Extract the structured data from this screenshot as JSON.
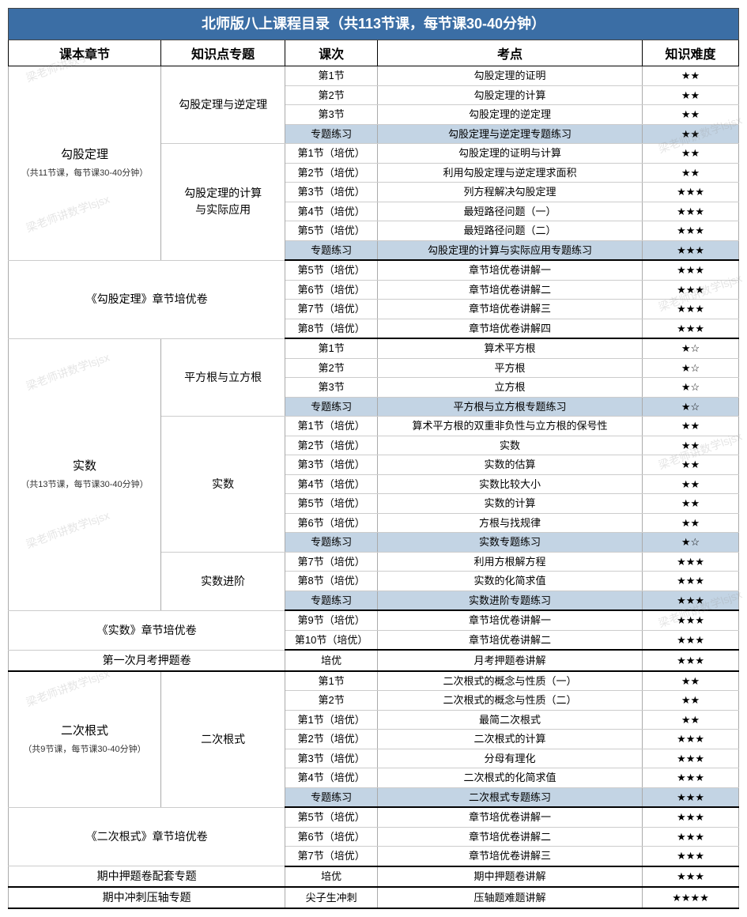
{
  "title": "北师版八上课程目录（共113节课，每节课30-40分钟）",
  "headers": [
    "课本章节",
    "知识点专题",
    "课次",
    "考点",
    "知识难度"
  ],
  "watermark": "梁老师讲数学lsjsx",
  "chapters": {
    "gougu": {
      "name": "勾股定理",
      "sub": "（共11节课，每节课30-40分钟）"
    },
    "gougu_topic1": "勾股定理与逆定理",
    "gougu_topic2_l1": "勾股定理的计算",
    "gougu_topic2_l2": "与实际应用",
    "gougu_exam": "《勾股定理》章节培优卷",
    "shishu": {
      "name": "实数",
      "sub": "（共13节课，每节课30-40分钟）"
    },
    "shishu_topic1": "平方根与立方根",
    "shishu_topic2": "实数",
    "shishu_topic3": "实数进阶",
    "shishu_exam": "《实数》章节培优卷",
    "monthly1": "第一次月考押题卷",
    "erci": {
      "name": "二次根式",
      "sub": "（共9节课，每节课30-40分钟）"
    },
    "erci_topic1": "二次根式",
    "erci_exam": "《二次根式》章节培优卷",
    "midterm1": "期中押题卷配套专题",
    "midterm2": "期中冲刺压轴专题"
  },
  "rows": [
    {
      "lesson": "第1节",
      "point": "勾股定理的证明",
      "diff": "★★"
    },
    {
      "lesson": "第2节",
      "point": "勾股定理的计算",
      "diff": "★★"
    },
    {
      "lesson": "第3节",
      "point": "勾股定理的逆定理",
      "diff": "★★"
    },
    {
      "lesson": "专题练习",
      "point": "勾股定理与逆定理专题练习",
      "diff": "★★",
      "hl": true
    },
    {
      "lesson": "第1节（培优）",
      "point": "勾股定理的证明与计算",
      "diff": "★★"
    },
    {
      "lesson": "第2节（培优）",
      "point": "利用勾股定理与逆定理求面积",
      "diff": "★★"
    },
    {
      "lesson": "第3节（培优）",
      "point": "列方程解决勾股定理",
      "diff": "★★★"
    },
    {
      "lesson": "第4节（培优）",
      "point": "最短路径问题（一）",
      "diff": "★★★"
    },
    {
      "lesson": "第5节（培优）",
      "point": "最短路径问题（二）",
      "diff": "★★★"
    },
    {
      "lesson": "专题练习",
      "point": "勾股定理的计算与实际应用专题练习",
      "diff": "★★★",
      "hl": true
    },
    {
      "lesson": "第5节（培优）",
      "point": "章节培优卷讲解一",
      "diff": "★★★"
    },
    {
      "lesson": "第6节（培优）",
      "point": "章节培优卷讲解二",
      "diff": "★★★"
    },
    {
      "lesson": "第7节（培优）",
      "point": "章节培优卷讲解三",
      "diff": "★★★"
    },
    {
      "lesson": "第8节（培优）",
      "point": "章节培优卷讲解四",
      "diff": "★★★"
    },
    {
      "lesson": "第1节",
      "point": "算术平方根",
      "diff": "★☆"
    },
    {
      "lesson": "第2节",
      "point": "平方根",
      "diff": "★☆"
    },
    {
      "lesson": "第3节",
      "point": "立方根",
      "diff": "★☆"
    },
    {
      "lesson": "专题练习",
      "point": "平方根与立方根专题练习",
      "diff": "★☆",
      "hl": true
    },
    {
      "lesson": "第1节（培优）",
      "point": "算术平方根的双重非负性与立方根的保号性",
      "diff": "★★"
    },
    {
      "lesson": "第2节（培优）",
      "point": "实数",
      "diff": "★★"
    },
    {
      "lesson": "第3节（培优）",
      "point": "实数的估算",
      "diff": "★★"
    },
    {
      "lesson": "第4节（培优）",
      "point": "实数比较大小",
      "diff": "★★"
    },
    {
      "lesson": "第5节（培优）",
      "point": "实数的计算",
      "diff": "★★"
    },
    {
      "lesson": "第6节（培优）",
      "point": "方根与找规律",
      "diff": "★★"
    },
    {
      "lesson": "专题练习",
      "point": "实数专题练习",
      "diff": "★☆",
      "hl": true
    },
    {
      "lesson": "第7节（培优）",
      "point": "利用方根解方程",
      "diff": "★★★"
    },
    {
      "lesson": "第8节（培优）",
      "point": "实数的化简求值",
      "diff": "★★★"
    },
    {
      "lesson": "专题练习",
      "point": "实数进阶专题练习",
      "diff": "★★★",
      "hl": true
    },
    {
      "lesson": "第9节（培优）",
      "point": "章节培优卷讲解一",
      "diff": "★★★"
    },
    {
      "lesson": "第10节（培优）",
      "point": "章节培优卷讲解二",
      "diff": "★★★"
    },
    {
      "lesson": "培优",
      "point": "月考押题卷讲解",
      "diff": "★★★"
    },
    {
      "lesson": "第1节",
      "point": "二次根式的概念与性质（一）",
      "diff": "★★"
    },
    {
      "lesson": "第2节",
      "point": "二次根式的概念与性质（二）",
      "diff": "★★"
    },
    {
      "lesson": "第1节（培优）",
      "point": "最简二次根式",
      "diff": "★★"
    },
    {
      "lesson": "第2节（培优）",
      "point": "二次根式的计算",
      "diff": "★★★"
    },
    {
      "lesson": "第3节（培优）",
      "point": "分母有理化",
      "diff": "★★★"
    },
    {
      "lesson": "第4节（培优）",
      "point": "二次根式的化简求值",
      "diff": "★★★"
    },
    {
      "lesson": "专题练习",
      "point": "二次根式专题练习",
      "diff": "★★★",
      "hl": true
    },
    {
      "lesson": "第5节（培优）",
      "point": "章节培优卷讲解一",
      "diff": "★★★"
    },
    {
      "lesson": "第6节（培优）",
      "point": "章节培优卷讲解二",
      "diff": "★★★"
    },
    {
      "lesson": "第7节（培优）",
      "point": "章节培优卷讲解三",
      "diff": "★★★"
    },
    {
      "lesson": "培优",
      "point": "期中押题卷讲解",
      "diff": "★★★"
    },
    {
      "lesson": "尖子生冲刺",
      "point": "压轴题难题讲解",
      "diff": "★★★★"
    }
  ]
}
